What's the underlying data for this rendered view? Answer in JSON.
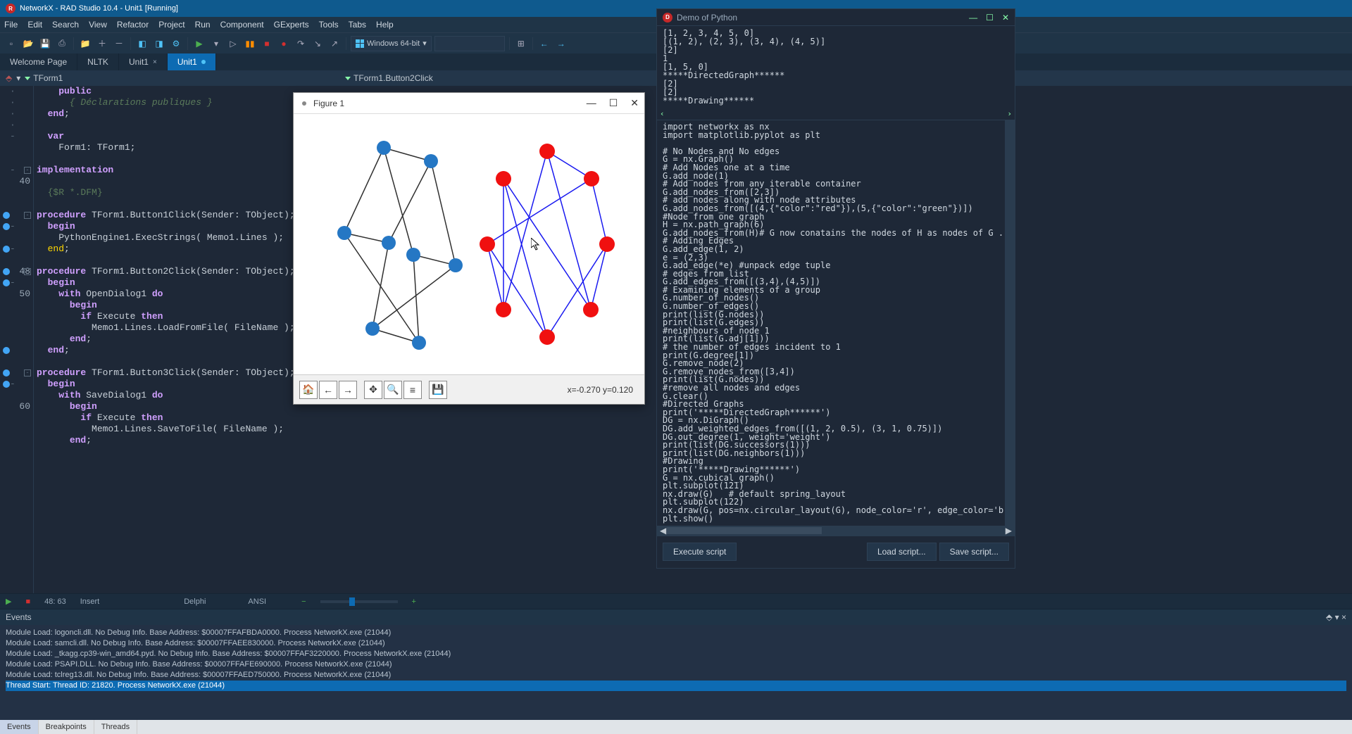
{
  "titlebar": {
    "title": "NetworkX - RAD Studio 10.4 - Unit1 [Running]"
  },
  "menu": [
    "File",
    "Edit",
    "Search",
    "View",
    "Refactor",
    "Project",
    "Run",
    "Component",
    "GExperts",
    "Tools",
    "Tabs",
    "Help"
  ],
  "toolbar": {
    "platform": "Windows 64-bit"
  },
  "tabs": [
    {
      "label": "Welcome Page",
      "active": false
    },
    {
      "label": "NLTK",
      "active": false
    },
    {
      "label": "Unit1",
      "active": false
    },
    {
      "label": "Unit1",
      "active": true,
      "modified": true
    }
  ],
  "formnav": {
    "form": "TForm1",
    "method": "TForm1.Button2Click"
  },
  "code_lines": [
    {
      "n": "",
      "g": "·",
      "txt": "    public"
    },
    {
      "n": "",
      "g": "·",
      "txt": "      { Déclarations publiques }",
      "cm": true
    },
    {
      "n": "",
      "g": "·",
      "txt": "  end;"
    },
    {
      "n": "",
      "g": "·",
      "txt": ""
    },
    {
      "n": "",
      "g": "-",
      "txt": "  var"
    },
    {
      "n": "",
      "g": "",
      "txt": "    Form1: TForm1;"
    },
    {
      "n": "",
      "g": "",
      "txt": ""
    },
    {
      "n": "",
      "g": "-",
      "fold": "-",
      "txt": "implementation",
      "kw": true
    },
    {
      "n": "40",
      "g": "",
      "txt": ""
    },
    {
      "n": "",
      "g": "",
      "txt": "  {$R *.DFM}",
      "dir": true
    },
    {
      "n": "",
      "g": "",
      "txt": ""
    },
    {
      "n": "",
      "g": "",
      "bp": true,
      "fold": "-",
      "txt": "procedure TForm1.Button1Click(Sender: TObject);",
      "proc": true
    },
    {
      "n": "",
      "g": "-",
      "bp": true,
      "txt": "  begin"
    },
    {
      "n": "",
      "g": "",
      "txt": "    PythonEngine1.ExecStrings( Memo1.Lines );"
    },
    {
      "n": "",
      "g": "-",
      "bp": true,
      "txt": "  end;",
      "hl": true
    },
    {
      "n": "",
      "g": "",
      "txt": ""
    },
    {
      "n": "48",
      "g": "",
      "bp": true,
      "fold": "-",
      "txt": "procedure TForm1.Button2Click(Sender: TObject);",
      "proc": true,
      "cursor": true
    },
    {
      "n": "",
      "g": "-",
      "bp": true,
      "txt": "  begin"
    },
    {
      "n": "50",
      "g": "",
      "txt": "    with OpenDialog1 do"
    },
    {
      "n": "",
      "g": "",
      "txt": "      begin"
    },
    {
      "n": "",
      "g": "",
      "txt": "        if Execute then"
    },
    {
      "n": "",
      "g": "",
      "txt": "          Memo1.Lines.LoadFromFile( FileName );"
    },
    {
      "n": "",
      "g": "",
      "txt": "      end;"
    },
    {
      "n": "",
      "g": "",
      "bp": true,
      "txt": "  end;"
    },
    {
      "n": "",
      "g": "",
      "txt": ""
    },
    {
      "n": "",
      "g": "",
      "bp": true,
      "fold": "-",
      "txt": "procedure TForm1.Button3Click(Sender: TObject);",
      "proc": true
    },
    {
      "n": "",
      "g": "-",
      "bp": true,
      "txt": "  begin"
    },
    {
      "n": "",
      "g": "",
      "txt": "    with SaveDialog1 do"
    },
    {
      "n": "60",
      "g": "",
      "txt": "      begin"
    },
    {
      "n": "",
      "g": "",
      "txt": "        if Execute then"
    },
    {
      "n": "",
      "g": "",
      "txt": "          Memo1.Lines.SaveToFile( FileName );"
    },
    {
      "n": "",
      "g": "",
      "txt": "      end;"
    },
    {
      "n": "",
      "g": "",
      "txt": ""
    }
  ],
  "statusbar": {
    "pos": "48: 63",
    "mode": "Insert",
    "lang": "Delphi",
    "enc": "ANSI"
  },
  "events": {
    "header": "Events",
    "lines": [
      "Module Load: logoncli.dll. No Debug Info. Base Address: $00007FFAFBDA0000. Process NetworkX.exe (21044)",
      "Module Load: samcli.dll. No Debug Info. Base Address: $00007FFAEE830000. Process NetworkX.exe (21044)",
      "Module Load: _tkagg.cp39-win_amd64.pyd. No Debug Info. Base Address: $00007FFAF3220000. Process NetworkX.exe (21044)",
      "Module Load: PSAPI.DLL. No Debug Info. Base Address: $00007FFAFE690000. Process NetworkX.exe (21044)",
      "Module Load: tclreg13.dll. No Debug Info. Base Address: $00007FFAED750000. Process NetworkX.exe (21044)",
      "Thread Start: Thread ID: 21820. Process NetworkX.exe (21044)"
    ],
    "tabs": [
      "Events",
      "Breakpoints",
      "Threads"
    ]
  },
  "figure": {
    "title": "Figure 1",
    "coords": "x=-0.270 y=0.120"
  },
  "pydemo": {
    "title": "Demo of Python",
    "output": "[1, 2, 3, 4, 5, 0]\n[(1, 2), (2, 3), (3, 4), (4, 5)]\n[2]\n1\n[1, 5, 0]\n*****DirectedGraph******\n[2]\n[2]\n*****Drawing******",
    "code": "import networkx as nx\nimport matplotlib.pyplot as plt\n\n# No Nodes and No edges\nG = nx.Graph()\n# Add Nodes one at a time\nG.add_node(1)\n# Add nodes from any iterable container\nG.add_nodes_from([2,3])\n# add nodes along with node attributes\nG.add_nodes_from([(4,{\"color\":\"red\"}),(5,{\"color\":\"green\"})])\n#Node from one graph\nH = nx.path_graph(6)\nG.add_nodes_from(H)# G now conatains the nodes of H as nodes of G . You could see the gra\n# Adding Edges\nG.add_edge(1, 2)\ne = (2,3)\nG.add_edge(*e) #unpack edge tuple\n# edges from list\nG.add_edges_from([(3,4),(4,5)])\n# Examining elements of a group\nG.number_of_nodes()\nG.number_of_edges()\nprint(list(G.nodes))\nprint(list(G.edges))\n#neighbours of node 1\nprint(list(G.adj[1]))\n# the number of edges incident to 1\nprint(G.degree[1])\nG.remove_node(2)\nG.remove_nodes_from([3,4])\nprint(list(G.nodes))\n#remove all nodes and edges\nG.clear()\n#Directed Graphs\nprint('*****DirectedGraph******')\nDG = nx.DiGraph()\nDG.add_weighted_edges_from([(1, 2, 0.5), (3, 1, 0.75)])\nDG.out_degree(1, weight='weight')\nprint(list(DG.successors(1)))\nprint(list(DG.neighbors(1)))\n#Drawing\nprint('*****Drawing******')\nG = nx.cubical_graph()\nplt.subplot(121)\nnx.draw(G)   # default spring_layout\nplt.subplot(122)\nnx.draw(G, pos=nx.circular_layout(G), node_color='r', edge_color='b')\nplt.show()",
    "buttons": {
      "exec": "Execute script",
      "load": "Load script...",
      "save": "Save script..."
    }
  },
  "chart_data": [
    {
      "type": "network-graph",
      "layout": "spring_layout",
      "node_color": "blue",
      "edge_color": "black",
      "nodes": [
        0,
        1,
        2,
        3,
        4,
        5,
        6,
        7
      ],
      "edges": [
        [
          0,
          1
        ],
        [
          0,
          3
        ],
        [
          0,
          4
        ],
        [
          1,
          2
        ],
        [
          1,
          7
        ],
        [
          2,
          3
        ],
        [
          2,
          6
        ],
        [
          3,
          5
        ],
        [
          4,
          5
        ],
        [
          4,
          7
        ],
        [
          5,
          6
        ],
        [
          6,
          7
        ]
      ]
    },
    {
      "type": "network-graph",
      "layout": "circular_layout",
      "node_color": "red",
      "edge_color": "blue",
      "nodes": [
        0,
        1,
        2,
        3,
        4,
        5,
        6,
        7
      ],
      "edges": [
        [
          0,
          1
        ],
        [
          0,
          3
        ],
        [
          0,
          4
        ],
        [
          1,
          2
        ],
        [
          1,
          7
        ],
        [
          2,
          3
        ],
        [
          2,
          6
        ],
        [
          3,
          5
        ],
        [
          4,
          5
        ],
        [
          4,
          7
        ],
        [
          5,
          6
        ],
        [
          6,
          7
        ]
      ]
    }
  ]
}
